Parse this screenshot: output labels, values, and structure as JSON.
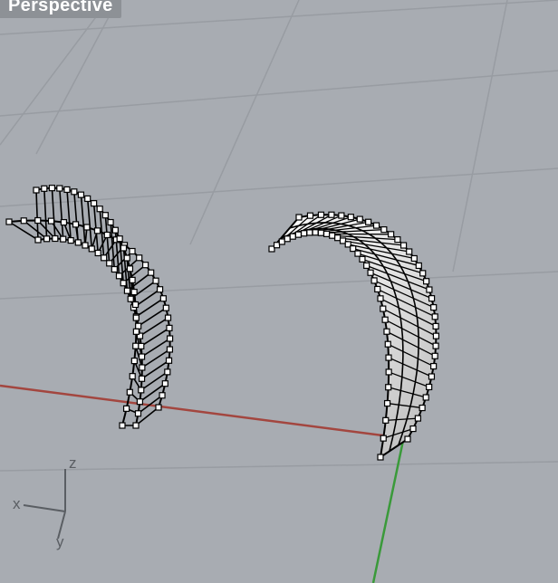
{
  "viewport": {
    "title": "Perspective",
    "background": "#a8acb2"
  },
  "axes": {
    "x_label": "x",
    "y_label": "y",
    "z_label": "z",
    "x_axis_color": "#a3463f",
    "y_axis_color": "#3a9a3a",
    "grid_color": "#989ca2"
  },
  "objects": [
    {
      "name": "left-surface-control-points",
      "state": "control-points-on"
    },
    {
      "name": "right-shaded-surface",
      "state": "selected-with-control-points"
    }
  ]
}
